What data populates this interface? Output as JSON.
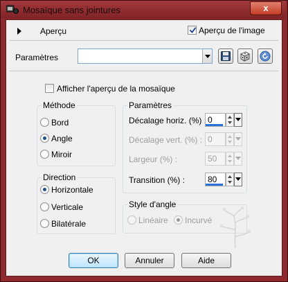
{
  "window": {
    "title": "Mosaïque sans jointures",
    "close_label": "x"
  },
  "preview": {
    "toggle_label": "Aperçu",
    "image_preview_label": "Aperçu de l'image",
    "image_preview_checked": true
  },
  "presets": {
    "label": "Paramètres",
    "value": ""
  },
  "mosaic_preview": {
    "label": "Afficher l'aperçu de la mosaïque",
    "checked": false
  },
  "method": {
    "title": "Méthode",
    "options": [
      "Bord",
      "Angle",
      "Miroir"
    ],
    "selected": "Angle"
  },
  "direction": {
    "title": "Direction",
    "options": [
      "Horizontale",
      "Verticale",
      "Bilatérale"
    ],
    "selected": "Horizontale"
  },
  "settings": {
    "title": "Paramètres",
    "fields": [
      {
        "label": "Décalage horiz. (%) :",
        "value": "0",
        "enabled": true,
        "level": 0
      },
      {
        "label": "Décalage vert. (%) :",
        "value": "0",
        "enabled": false,
        "level": 0
      },
      {
        "label": "Largeur (%) :",
        "value": "50",
        "enabled": false,
        "level": 0.5
      },
      {
        "label": "Transition (%) :",
        "value": "80",
        "enabled": true,
        "level": 0.8
      }
    ]
  },
  "corner_style": {
    "title": "Style d'angle",
    "options": [
      "Linéaire",
      "Incurvé"
    ],
    "selected": "Incurvé",
    "enabled": false
  },
  "buttons": {
    "ok": "OK",
    "cancel": "Annuler",
    "help": "Aide"
  },
  "colors": {
    "frame": "#8e2a2e",
    "client_bg": "#f0f0f0",
    "accent_bar": "#2a72d8"
  }
}
